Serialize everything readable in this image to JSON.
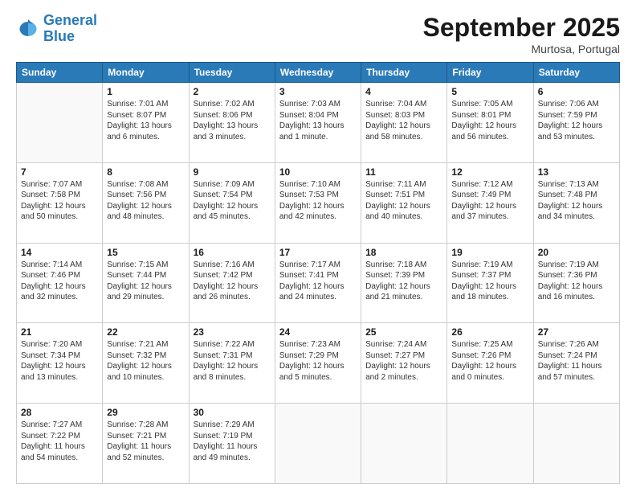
{
  "logo": {
    "line1": "General",
    "line2": "Blue"
  },
  "title": "September 2025",
  "subtitle": "Murtosa, Portugal",
  "days_of_week": [
    "Sunday",
    "Monday",
    "Tuesday",
    "Wednesday",
    "Thursday",
    "Friday",
    "Saturday"
  ],
  "weeks": [
    [
      {
        "num": "",
        "info": ""
      },
      {
        "num": "1",
        "info": "Sunrise: 7:01 AM\nSunset: 8:07 PM\nDaylight: 13 hours\nand 6 minutes."
      },
      {
        "num": "2",
        "info": "Sunrise: 7:02 AM\nSunset: 8:06 PM\nDaylight: 13 hours\nand 3 minutes."
      },
      {
        "num": "3",
        "info": "Sunrise: 7:03 AM\nSunset: 8:04 PM\nDaylight: 13 hours\nand 1 minute."
      },
      {
        "num": "4",
        "info": "Sunrise: 7:04 AM\nSunset: 8:03 PM\nDaylight: 12 hours\nand 58 minutes."
      },
      {
        "num": "5",
        "info": "Sunrise: 7:05 AM\nSunset: 8:01 PM\nDaylight: 12 hours\nand 56 minutes."
      },
      {
        "num": "6",
        "info": "Sunrise: 7:06 AM\nSunset: 7:59 PM\nDaylight: 12 hours\nand 53 minutes."
      }
    ],
    [
      {
        "num": "7",
        "info": "Sunrise: 7:07 AM\nSunset: 7:58 PM\nDaylight: 12 hours\nand 50 minutes."
      },
      {
        "num": "8",
        "info": "Sunrise: 7:08 AM\nSunset: 7:56 PM\nDaylight: 12 hours\nand 48 minutes."
      },
      {
        "num": "9",
        "info": "Sunrise: 7:09 AM\nSunset: 7:54 PM\nDaylight: 12 hours\nand 45 minutes."
      },
      {
        "num": "10",
        "info": "Sunrise: 7:10 AM\nSunset: 7:53 PM\nDaylight: 12 hours\nand 42 minutes."
      },
      {
        "num": "11",
        "info": "Sunrise: 7:11 AM\nSunset: 7:51 PM\nDaylight: 12 hours\nand 40 minutes."
      },
      {
        "num": "12",
        "info": "Sunrise: 7:12 AM\nSunset: 7:49 PM\nDaylight: 12 hours\nand 37 minutes."
      },
      {
        "num": "13",
        "info": "Sunrise: 7:13 AM\nSunset: 7:48 PM\nDaylight: 12 hours\nand 34 minutes."
      }
    ],
    [
      {
        "num": "14",
        "info": "Sunrise: 7:14 AM\nSunset: 7:46 PM\nDaylight: 12 hours\nand 32 minutes."
      },
      {
        "num": "15",
        "info": "Sunrise: 7:15 AM\nSunset: 7:44 PM\nDaylight: 12 hours\nand 29 minutes."
      },
      {
        "num": "16",
        "info": "Sunrise: 7:16 AM\nSunset: 7:42 PM\nDaylight: 12 hours\nand 26 minutes."
      },
      {
        "num": "17",
        "info": "Sunrise: 7:17 AM\nSunset: 7:41 PM\nDaylight: 12 hours\nand 24 minutes."
      },
      {
        "num": "18",
        "info": "Sunrise: 7:18 AM\nSunset: 7:39 PM\nDaylight: 12 hours\nand 21 minutes."
      },
      {
        "num": "19",
        "info": "Sunrise: 7:19 AM\nSunset: 7:37 PM\nDaylight: 12 hours\nand 18 minutes."
      },
      {
        "num": "20",
        "info": "Sunrise: 7:19 AM\nSunset: 7:36 PM\nDaylight: 12 hours\nand 16 minutes."
      }
    ],
    [
      {
        "num": "21",
        "info": "Sunrise: 7:20 AM\nSunset: 7:34 PM\nDaylight: 12 hours\nand 13 minutes."
      },
      {
        "num": "22",
        "info": "Sunrise: 7:21 AM\nSunset: 7:32 PM\nDaylight: 12 hours\nand 10 minutes."
      },
      {
        "num": "23",
        "info": "Sunrise: 7:22 AM\nSunset: 7:31 PM\nDaylight: 12 hours\nand 8 minutes."
      },
      {
        "num": "24",
        "info": "Sunrise: 7:23 AM\nSunset: 7:29 PM\nDaylight: 12 hours\nand 5 minutes."
      },
      {
        "num": "25",
        "info": "Sunrise: 7:24 AM\nSunset: 7:27 PM\nDaylight: 12 hours\nand 2 minutes."
      },
      {
        "num": "26",
        "info": "Sunrise: 7:25 AM\nSunset: 7:26 PM\nDaylight: 12 hours\nand 0 minutes."
      },
      {
        "num": "27",
        "info": "Sunrise: 7:26 AM\nSunset: 7:24 PM\nDaylight: 11 hours\nand 57 minutes."
      }
    ],
    [
      {
        "num": "28",
        "info": "Sunrise: 7:27 AM\nSunset: 7:22 PM\nDaylight: 11 hours\nand 54 minutes."
      },
      {
        "num": "29",
        "info": "Sunrise: 7:28 AM\nSunset: 7:21 PM\nDaylight: 11 hours\nand 52 minutes."
      },
      {
        "num": "30",
        "info": "Sunrise: 7:29 AM\nSunset: 7:19 PM\nDaylight: 11 hours\nand 49 minutes."
      },
      {
        "num": "",
        "info": ""
      },
      {
        "num": "",
        "info": ""
      },
      {
        "num": "",
        "info": ""
      },
      {
        "num": "",
        "info": ""
      }
    ]
  ]
}
